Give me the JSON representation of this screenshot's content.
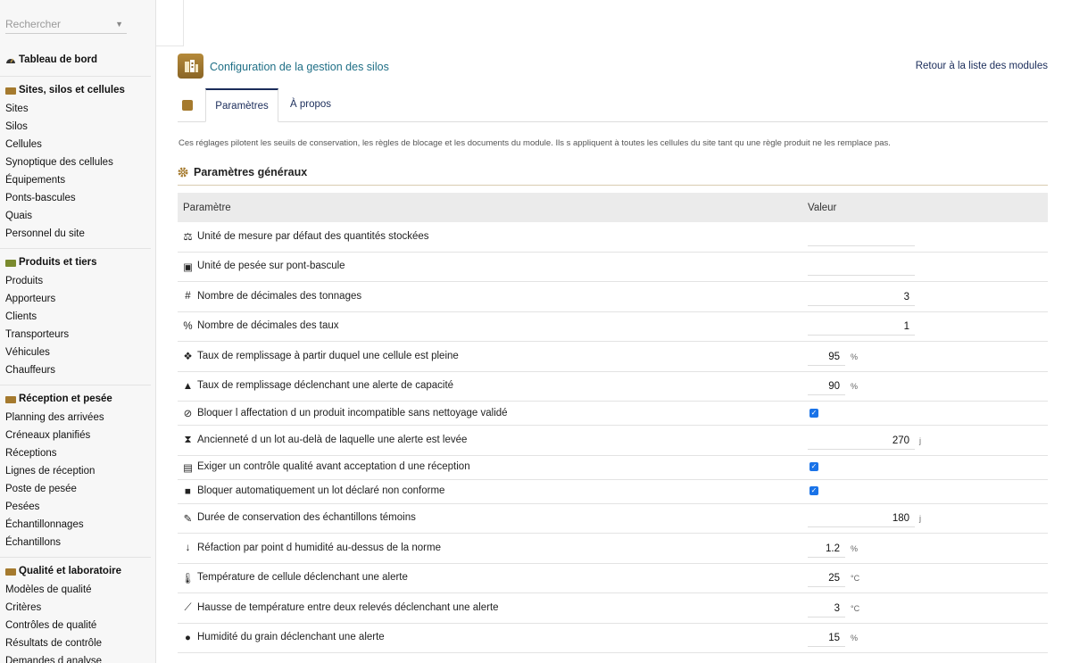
{
  "search": {
    "placeholder": "Rechercher"
  },
  "sidebar": {
    "dashboard": "Tableau de bord",
    "sections": [
      {
        "title": "Sites, silos et cellules",
        "items": [
          "Sites",
          "Silos",
          "Cellules",
          "Synoptique des cellules",
          "Équipements",
          "Ponts-bascules",
          "Quais",
          "Personnel du site"
        ]
      },
      {
        "title": "Produits et tiers",
        "items": [
          "Produits",
          "Apporteurs",
          "Clients",
          "Transporteurs",
          "Véhicules",
          "Chauffeurs"
        ]
      },
      {
        "title": "Réception et pesée",
        "items": [
          "Planning des arrivées",
          "Créneaux planifiés",
          "Réceptions",
          "Lignes de réception",
          "Poste de pesée",
          "Pesées",
          "Échantillonnages",
          "Échantillons"
        ]
      },
      {
        "title": "Qualité et laboratoire",
        "items": [
          "Modèles de qualité",
          "Critères",
          "Contrôles de qualité",
          "Résultats de contrôle",
          "Demandes d analyse"
        ]
      }
    ]
  },
  "header": {
    "title": "Configuration de la gestion des silos",
    "back_link": "Retour à la liste des modules"
  },
  "tabs": {
    "params": "Paramètres",
    "about": "À propos"
  },
  "description": "Ces réglages pilotent les seuils de conservation, les règles de blocage et les documents du module. Ils s appliquent à toutes les cellules du site tant qu une règle produit ne les remplace pas.",
  "section_title": "Paramètres généraux",
  "table": {
    "col_param": "Paramètre",
    "col_value": "Valeur",
    "rows": [
      {
        "icon": "scale-icon",
        "label": "Unité de mesure par défaut des quantités stockées",
        "value": "",
        "unit": ""
      },
      {
        "icon": "weighing-icon",
        "label": "Unité de pesée sur pont-bascule",
        "value": "",
        "unit": ""
      },
      {
        "icon": "hash-icon",
        "label": "Nombre de décimales des tonnages",
        "value": "3",
        "unit": ""
      },
      {
        "icon": "percent-icon",
        "label": "Nombre de décimales des taux",
        "value": "1",
        "unit": ""
      },
      {
        "icon": "cubes-icon",
        "label": "Taux de remplissage à partir duquel une cellule est pleine",
        "value": "95",
        "unit": "%"
      },
      {
        "icon": "warning-icon",
        "label": "Taux de remplissage déclenchant une alerte de capacité",
        "value": "90",
        "unit": "%"
      },
      {
        "icon": "ban-icon",
        "label": "Bloquer l affectation d un produit incompatible sans nettoyage validé",
        "checked": true
      },
      {
        "icon": "hourglass-icon",
        "label": "Ancienneté d un lot au-delà de laquelle une alerte est levée",
        "value": "270",
        "unit": "j"
      },
      {
        "icon": "clipboard-check-icon",
        "label": "Exiger un contrôle qualité avant acceptation d une réception",
        "checked": true
      },
      {
        "icon": "lock-icon",
        "label": "Bloquer automatiquement un lot déclaré non conforme",
        "checked": true
      },
      {
        "icon": "eyedropper-icon",
        "label": "Durée de conservation des échantillons témoins",
        "value": "180",
        "unit": "j"
      },
      {
        "icon": "arrow-down-icon",
        "label": "Réfaction par point d humidité au-dessus de la norme",
        "value": "1.2",
        "unit": "%"
      },
      {
        "icon": "thermometer-icon",
        "label": "Température de cellule déclenchant une alerte",
        "value": "25",
        "unit": "°C"
      },
      {
        "icon": "chart-line-icon",
        "label": "Hausse de température entre deux relevés déclenchant une alerte",
        "value": "3",
        "unit": "°C"
      },
      {
        "icon": "droplet-icon",
        "label": "Humidité du grain déclenchant une alerte",
        "value": "15",
        "unit": "%"
      }
    ]
  }
}
